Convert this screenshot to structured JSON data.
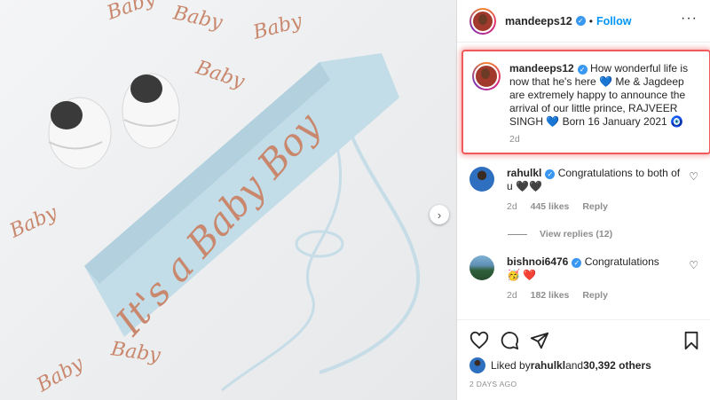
{
  "photo": {
    "sash_text": "It's a Baby Boy",
    "confetti_word": "Baby",
    "next_icon": "chevron-right-icon"
  },
  "header": {
    "username": "mandeeps12",
    "separator": "•",
    "follow_label": "Follow",
    "more_icon": "ellipsis-icon"
  },
  "caption": {
    "username": "mandeeps12",
    "text_1": " How wonderful life is now that he's here ",
    "emoji_1": "💙",
    "text_2": " Me & Jagdeep are extremely happy to announce the arrival of our little prince, RAJVEER SINGH ",
    "emoji_2": "💙",
    "text_3": " Born 16 January 2021 ",
    "emoji_3": "🧿",
    "time": "2d"
  },
  "comments": [
    {
      "username": "rahulkl",
      "text": " Congratulations to both of u ",
      "emoji": "🖤🖤",
      "time": "2d",
      "likes": "445 likes",
      "reply": "Reply"
    },
    {
      "username": "bishnoi6476",
      "text": " Congratulations",
      "emoji": "🥳 ❤️",
      "time": "2d",
      "likes": "182 likes",
      "reply": "Reply"
    }
  ],
  "view_replies": "View replies (12)",
  "footer": {
    "liked_by": "Liked by ",
    "liked_user": "rahulkl",
    "and_others": " and ",
    "others_count": "30,392 others",
    "posted": "2 DAYS AGO"
  },
  "colors": {
    "accent": "#0095f6",
    "highlight_border": "#f05a5a",
    "rose_gold": "#c9886d",
    "sash": "#bcd9e6"
  }
}
